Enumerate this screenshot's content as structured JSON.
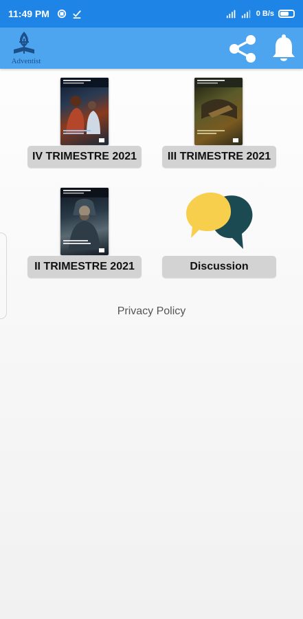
{
  "status_bar": {
    "time": "11:49 PM",
    "right_text": "0 B/s"
  },
  "app_bar": {
    "logo_text": "Adventist"
  },
  "grid": {
    "items": [
      {
        "label": "IV TRIMESTRE 2021",
        "type": "quarterly"
      },
      {
        "label": "III TRIMESTRE 2021",
        "type": "quarterly"
      },
      {
        "label": "II TRIMESTRE 2021",
        "type": "quarterly"
      },
      {
        "label": "Discussion",
        "type": "discussion"
      }
    ]
  },
  "footer": {
    "privacy_label": "Privacy Policy"
  },
  "colors": {
    "status_bar": "#1e84e6",
    "app_bar": "#4da5f0",
    "pill_bg": "#d3d3d3",
    "bubble_yellow": "#f7cf4d",
    "bubble_teal": "#1c4a52"
  }
}
